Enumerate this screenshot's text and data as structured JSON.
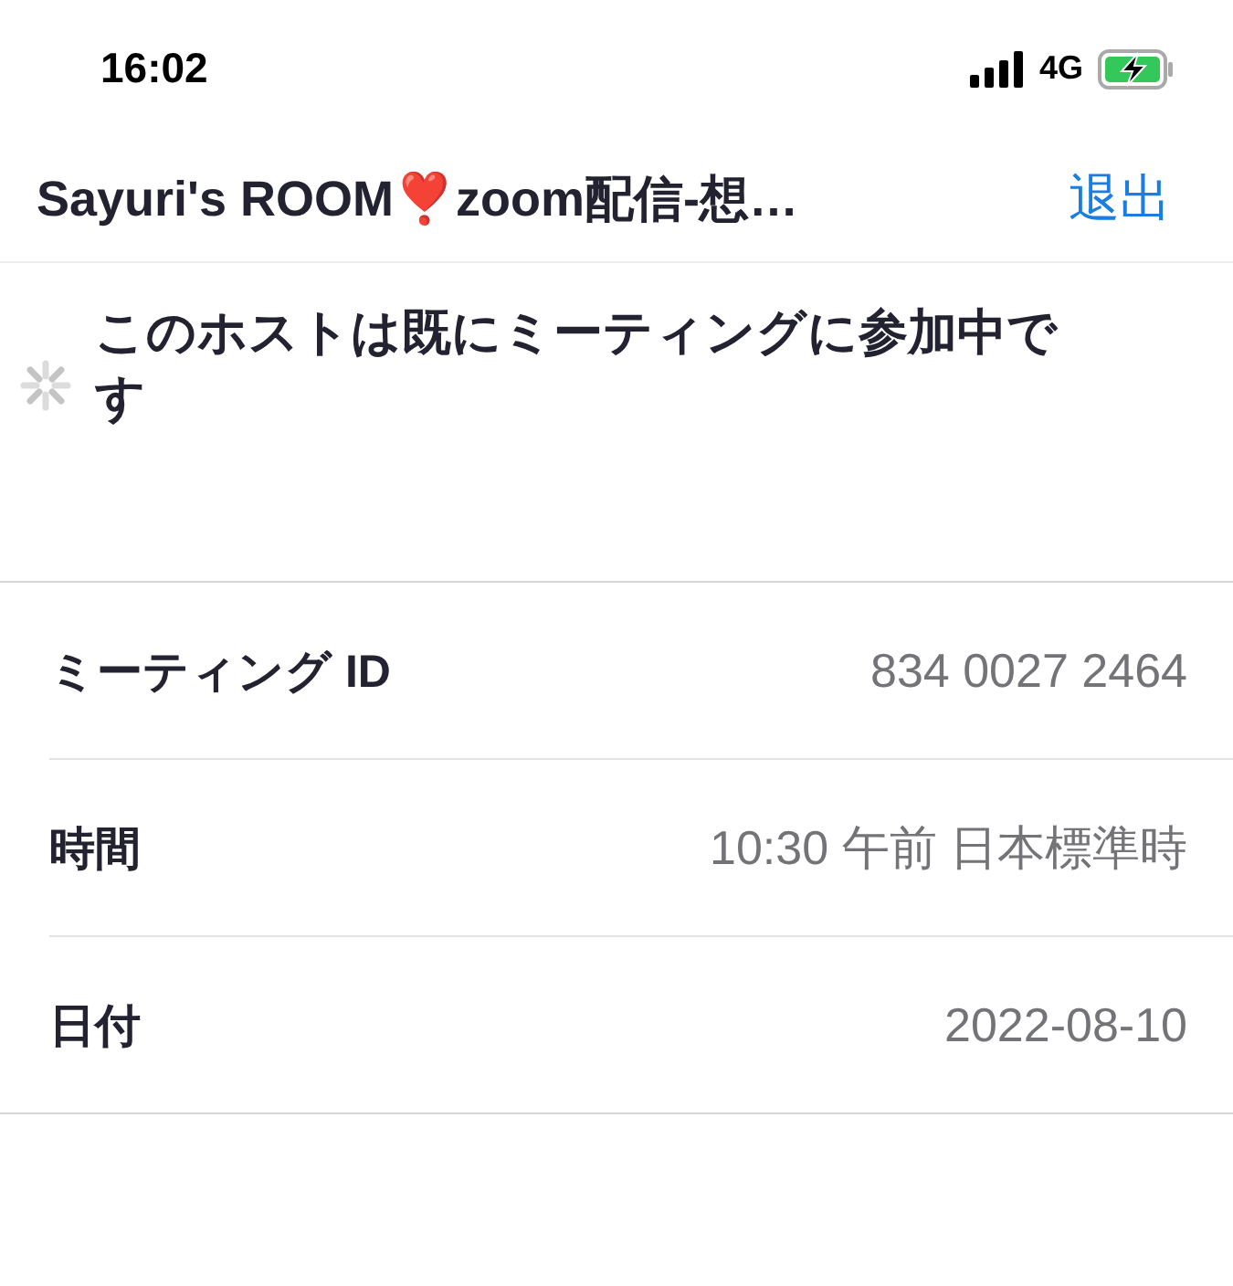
{
  "status_bar": {
    "time": "16:02",
    "network": "4G"
  },
  "nav_bar": {
    "title": "Sayuri's ROOM❣️zoom配信-想…",
    "action": "退出"
  },
  "message": {
    "loading": true,
    "text": "このホストは既にミーティングに参加中です"
  },
  "details": [
    {
      "label": "ミーティング ID",
      "value": "834 0027 2464"
    },
    {
      "label": "時間",
      "value": "10:30 午前 日本標準時"
    },
    {
      "label": "日付",
      "value": "2022-08-10"
    }
  ]
}
